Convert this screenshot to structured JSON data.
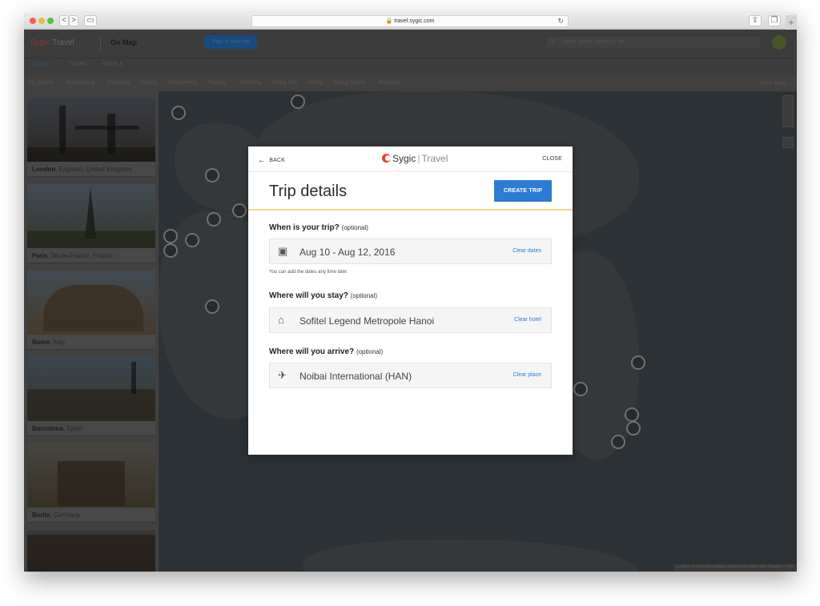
{
  "browser": {
    "url": "travel.sygic.com",
    "nav": [
      "<",
      ">"
    ]
  },
  "app": {
    "logo_name": "Sygic",
    "logo_sub": "Travel",
    "view_mode": "On Map",
    "plan_trip_button": "Plan a new trip",
    "search_placeholder": "Hotel, place, address, etc.",
    "tabs": [
      "PLACES",
      "TOURS",
      "HOTELS"
    ],
    "categories": [
      "My places",
      "Sightseeing",
      "Shopping",
      "Eating",
      "Discovering",
      "Playing",
      "Traveling",
      "Going Out",
      "Hiking",
      "Doing Sports",
      "Relaxing"
    ],
    "more_filters": "More filters"
  },
  "cards": [
    {
      "city": "London",
      "region": ", England, United Kingdom"
    },
    {
      "city": "Paris",
      "region": ", Île-de-France, France"
    },
    {
      "city": "Rome",
      "region": ", Italy"
    },
    {
      "city": "Barcelona",
      "region": ", Spain"
    },
    {
      "city": "Berlin",
      "region": ", Germany"
    }
  ],
  "map": {
    "attribution": "Leaflet | © OpenStreetMap contributors | Map data: Mapbox | Tiles"
  },
  "modal": {
    "back_label": "BACK",
    "close_label": "CLOSE",
    "logo_brand": "Sygic",
    "logo_product": "Travel",
    "title": "Trip details",
    "create_button": "CREATE TRIP",
    "when": {
      "question": "When is your trip?",
      "optional": "(optional)",
      "value": "Aug 10 - Aug 12, 2016",
      "clear": "Clear dates",
      "hint": "You can add the dates any time later."
    },
    "stay": {
      "question": "Where will you stay?",
      "optional": "(optional)",
      "value": "Sofitel Legend Metropole Hanoi",
      "clear": "Clear hotel"
    },
    "arrive": {
      "question": "Where will you arrive?",
      "optional": "(optional)",
      "value": "Noibai International (HAN)",
      "clear": "Clear place"
    }
  },
  "colors": {
    "accent": "#2d7bd3",
    "highlight_line": "#f0d68a",
    "logo_red": "#e2412b"
  }
}
